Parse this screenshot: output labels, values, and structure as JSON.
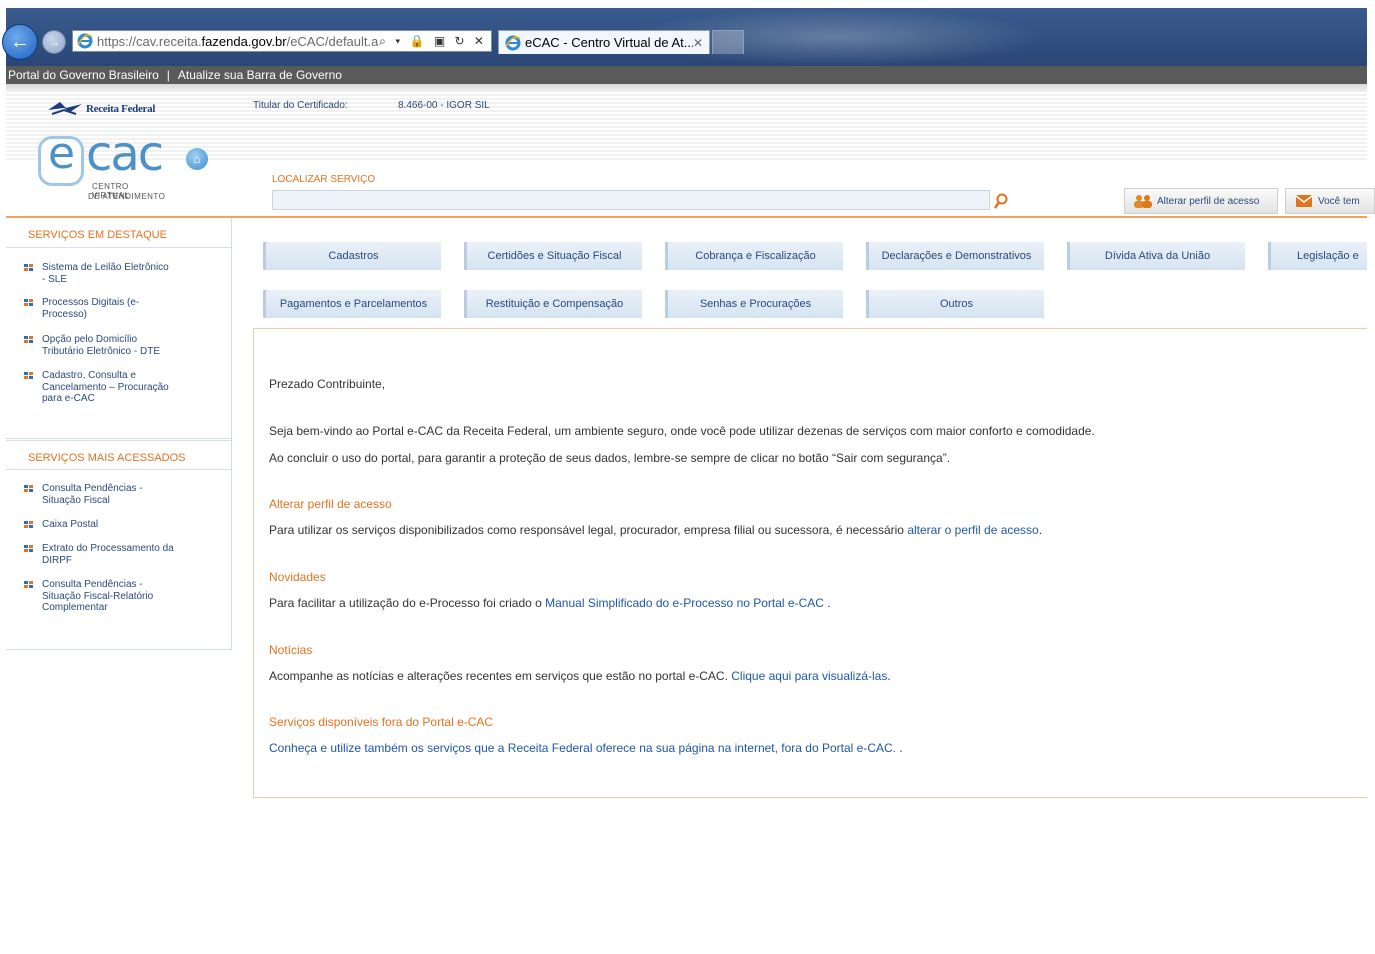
{
  "browser": {
    "url_prefix": "https://cav.receita.",
    "url_host": "fazenda.gov.br",
    "url_suffix": "/eCAC/default.a",
    "address_tools": "⌕ ▾ 🔒 ▣ ↻ ✕",
    "tab_title": "eCAC - Centro Virtual de At...",
    "tab_close": "✕"
  },
  "govbar": {
    "portal_link": "Portal do Governo Brasileiro",
    "separator": "|",
    "update_link": "Atualize sua Barra de Governo"
  },
  "header": {
    "rf_logo_text": "Receita Federal",
    "cert_label": "Titular do Certificado:",
    "cert_value": "8.466-00 - IGOR SIL",
    "ecac_letter": "e",
    "ecac_word": "cac",
    "ecac_sub1": "CENTRO VIRTUAL",
    "ecac_sub2": "DE ATENDIMENTO"
  },
  "search": {
    "label": "LOCALIZAR SERVIÇO",
    "value": "",
    "perfil_button": "Alterar perfil de acesso",
    "msg_button": "Você tem"
  },
  "sidebar": {
    "destaque_title": "SERVIÇOS EM DESTAQUE",
    "destaque_items": [
      [
        "Sistema de Leilão Eletrônico",
        "- SLE"
      ],
      [
        "Processos Digitais (e-",
        "Processo)"
      ],
      [
        "Opção pelo Domicílio",
        "Tributário Eletrônico - DTE"
      ],
      [
        "Cadastro, Consulta e",
        "Cancelamento – Procuração",
        "para e-CAC"
      ]
    ],
    "acessados_title": "SERVIÇOS MAIS ACESSADOS",
    "acessados_items": [
      [
        "Consulta Pendências -",
        "Situação Fiscal"
      ],
      [
        "Caixa Postal"
      ],
      [
        "Extrato do Processamento da",
        "DIRPF"
      ],
      [
        "Consulta Pendências -",
        "Situação Fiscal-Relatório",
        "Complementar"
      ]
    ]
  },
  "categories": {
    "row1": [
      "Cadastros",
      "Certidões e Situação Fiscal",
      "Cobrança e Fiscalização",
      "Declarações e Demonstrativos",
      "Dívida Ativa da União",
      "Legislação e"
    ],
    "row2": [
      "Pagamentos e Parcelamentos",
      "Restituição e Compensação",
      "Senhas e Procurações",
      "Outros"
    ]
  },
  "content": {
    "greeting": "Prezado Contribuinte,",
    "welcome": "Seja bem-vindo ao Portal e-CAC da Receita Federal, um ambiente seguro, onde você pode utilizar dezenas de serviços com maior conforto e comodidade.",
    "logout_note": "Ao concluir o uso do portal, para garantir a proteção de seus dados, lembre-se sempre de clicar no botão “Sair com segurança”.",
    "perfil_title": "Alterar perfil de acesso",
    "perfil_text": "Para utilizar os serviços disponibilizados como responsável legal, procurador, empresa filial ou sucessora, é necessário ",
    "perfil_link": "alterar o perfil de acesso",
    "perfil_end": ".",
    "novidades_title": "Novidades",
    "novidades_text": "Para facilitar a utilização do e-Processo foi criado o ",
    "novidades_link": "Manual Simplificado do e-Processo no Portal e-CAC",
    "novidades_end": " .",
    "noticias_title": "Notícias",
    "noticias_text": "Acompanhe as notícias e alterações recentes em serviços que estão no portal e-CAC. ",
    "noticias_link": "Clique aqui para visualizá-las",
    "noticias_end": ".",
    "fora_title": "Serviços disponíveis fora do Portal e-CAC",
    "fora_link": "Conheça e utilize também os serviços que a Receita Federal oferece na sua página na internet, fora do Portal e-CAC.",
    "fora_end": " ."
  },
  "colors": {
    "accent_orange": "#e2731f",
    "link_blue": "#1f57a7",
    "brand_blue": "#4e91c9"
  }
}
